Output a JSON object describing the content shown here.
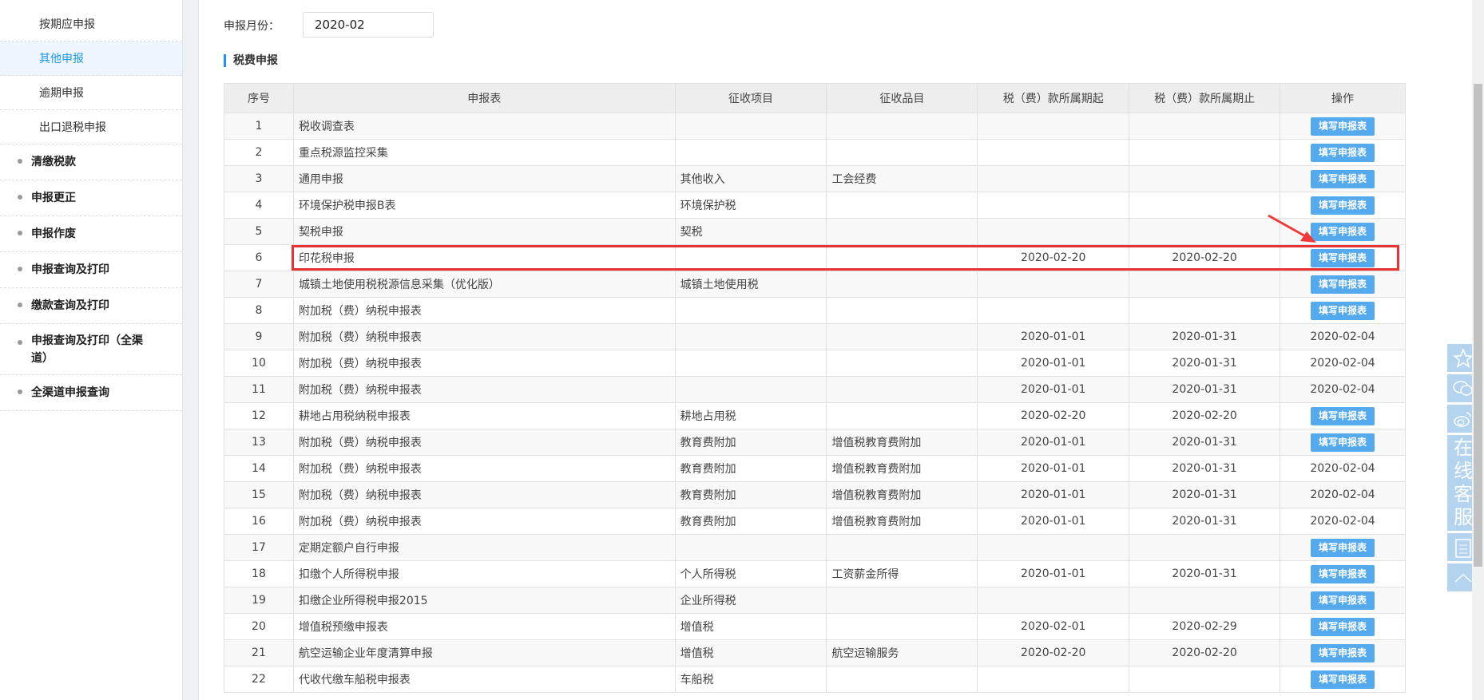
{
  "sidebar": {
    "sub_items": [
      "按期应申报",
      "其他申报",
      "逾期申报",
      "出口退税申报"
    ],
    "active": "其他申报",
    "main_items": [
      "清缴税款",
      "申报更正",
      "申报作废",
      "申报查询及打印",
      "缴款查询及打印",
      "申报查询及打印（全渠道）",
      "全渠道申报查询"
    ]
  },
  "form": {
    "month_label": "申报月份：",
    "month_value": "2020-02"
  },
  "section_title": "税费申报",
  "table": {
    "headers": [
      "序号",
      "申报表",
      "征收项目",
      "征收品目",
      "税（费）款所属期起",
      "税（费）款所属期止",
      "操作"
    ],
    "button_label": "填写申报表",
    "rows": [
      [
        "1",
        "税收调查表",
        "",
        "",
        "",
        "",
        ""
      ],
      [
        "2",
        "重点税源监控采集",
        "",
        "",
        "",
        "",
        ""
      ],
      [
        "3",
        "通用申报",
        "其他收入",
        "工会经费",
        "",
        "",
        ""
      ],
      [
        "4",
        "环境保护税申报B表",
        "环境保护税",
        "",
        "",
        "",
        ""
      ],
      [
        "5",
        "契税申报",
        "契税",
        "",
        "",
        "",
        ""
      ],
      [
        "6",
        "印花税申报",
        "",
        "",
        "2020-02-20",
        "2020-02-20",
        ""
      ],
      [
        "7",
        "城镇土地使用税税源信息采集（优化版）",
        "城镇土地使用税",
        "",
        "",
        "",
        ""
      ],
      [
        "8",
        "附加税（费）纳税申报表",
        "",
        "",
        "",
        "",
        ""
      ],
      [
        "9",
        "附加税（费）纳税申报表",
        "",
        "",
        "2020-01-01",
        "2020-01-31",
        "2020-02-04"
      ],
      [
        "10",
        "附加税（费）纳税申报表",
        "",
        "",
        "2020-01-01",
        "2020-01-31",
        "2020-02-04"
      ],
      [
        "11",
        "附加税（费）纳税申报表",
        "",
        "",
        "2020-01-01",
        "2020-01-31",
        "2020-02-04"
      ],
      [
        "12",
        "耕地占用税纳税申报表",
        "耕地占用税",
        "",
        "2020-02-20",
        "2020-02-20",
        ""
      ],
      [
        "13",
        "附加税（费）纳税申报表",
        "教育费附加",
        "增值税教育费附加",
        "2020-01-01",
        "2020-01-31",
        ""
      ],
      [
        "14",
        "附加税（费）纳税申报表",
        "教育费附加",
        "增值税教育费附加",
        "2020-01-01",
        "2020-01-31",
        "2020-02-04"
      ],
      [
        "15",
        "附加税（费）纳税申报表",
        "教育费附加",
        "增值税教育费附加",
        "2020-01-01",
        "2020-01-31",
        "2020-02-04"
      ],
      [
        "16",
        "附加税（费）纳税申报表",
        "教育费附加",
        "增值税教育费附加",
        "2020-01-01",
        "2020-01-31",
        "2020-02-04"
      ],
      [
        "17",
        "定期定额户自行申报",
        "",
        "",
        "",
        "",
        ""
      ],
      [
        "18",
        "扣缴个人所得税申报",
        "个人所得税",
        "工资薪金所得",
        "2020-01-01",
        "2020-01-31",
        ""
      ],
      [
        "19",
        "扣缴企业所得税申报2015",
        "企业所得税",
        "",
        "",
        "",
        ""
      ],
      [
        "20",
        "增值税预缴申报表",
        "增值税",
        "",
        "2020-02-01",
        "2020-02-29",
        ""
      ],
      [
        "21",
        "航空运输企业年度清算申报",
        "增值税",
        "航空运输服务",
        "2020-02-20",
        "2020-02-20",
        ""
      ],
      [
        "22",
        "代收代缴车船税申报表",
        "车船税",
        "",
        "",
        "",
        ""
      ]
    ]
  },
  "float_panel": {
    "service_text": "在线客服",
    "icons": [
      "star-icon",
      "wechat-icon",
      "weibo-icon",
      "notepad-icon",
      "up-arrow-icon"
    ]
  },
  "colors": {
    "accent": "#1a9be6",
    "button": "#55aaee",
    "highlight": "#e83333"
  }
}
